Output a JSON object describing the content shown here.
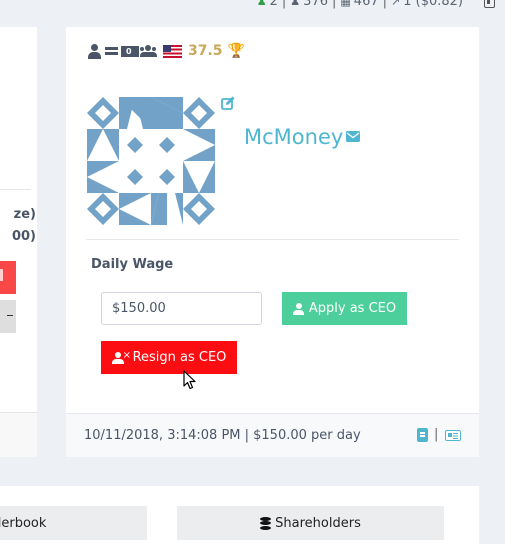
{
  "topbar": {
    "stat1": "2",
    "stat2": "376",
    "stat3": "467",
    "stat4": "1 ($0.82)",
    "sep": "|"
  },
  "left_card": {
    "line1": "ze)",
    "line2": "00)"
  },
  "company": {
    "stats_value": "37.5",
    "name": "McMoney",
    "identicon_color": "#73a2c8",
    "icons": [
      "ceo-icon",
      "equals-icon",
      "money-icon",
      "users-icon",
      "us-flag-icon",
      "trophy-icon"
    ]
  },
  "wage": {
    "label": "Daily Wage",
    "value": "$150.00",
    "apply_label": "Apply as CEO",
    "resign_label": "Resign as CEO"
  },
  "footer": {
    "text": "10/11/2018, 3:14:08 PM | $150.00 per day",
    "sep": "|"
  },
  "bottom_tabs": {
    "orderbook": "Orderbook",
    "orderbook_visible": "rderbook",
    "shareholders": "Shareholders"
  },
  "colors": {
    "accent": "#4fb6d0",
    "apply": "#4ccf9a",
    "resign": "#fc0d12",
    "gold": "#c8a85a"
  }
}
